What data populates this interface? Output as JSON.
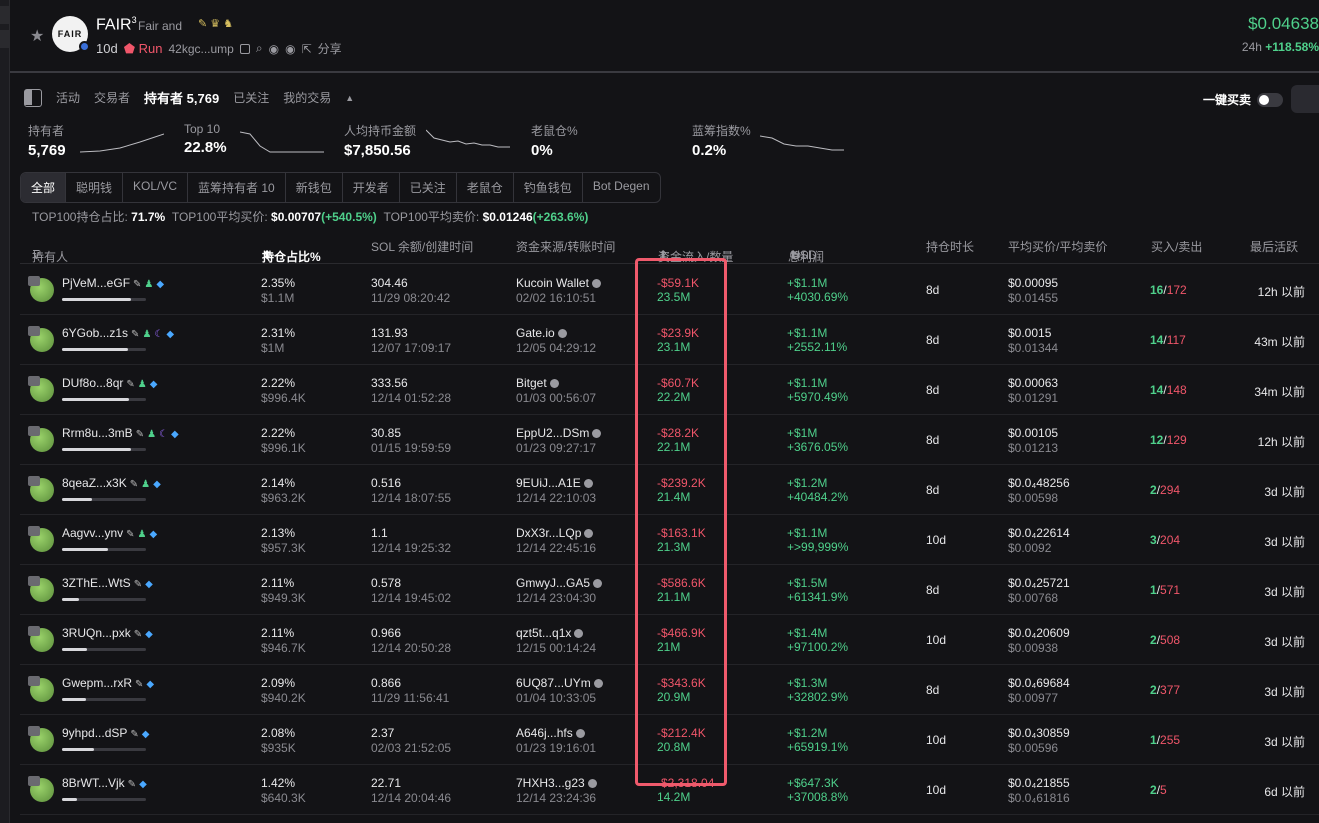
{
  "header": {
    "token_name": "FAIR",
    "token_sup": "3",
    "token_sub": "Fair and",
    "age": "10d",
    "run_label": "Run",
    "contract": "42kgc...ump",
    "share_label": "分享",
    "price": "$0.04638",
    "price_change_label": "24h",
    "price_change": "+118.58%",
    "logo_text": "FAIR"
  },
  "tabs": {
    "items": [
      "活动",
      "交易者"
    ],
    "active": "持有者 5,769",
    "extra": [
      "已关注",
      "我的交易"
    ],
    "quick_trade": "一键买卖"
  },
  "stats": [
    {
      "label": "持有者",
      "value": "5,769"
    },
    {
      "label": "Top 10",
      "value": "22.8%"
    },
    {
      "label": "人均持币金额",
      "value": "$7,850.56"
    },
    {
      "label": "老鼠仓%",
      "value": "0%"
    },
    {
      "label": "蓝筹指数%",
      "value": "0.2%"
    }
  ],
  "filters": [
    "全部",
    "聪明钱",
    "KOL/VC",
    "蓝筹持有者 10",
    "新钱包",
    "开发者",
    "已关注",
    "老鼠仓",
    "钓鱼钱包",
    "Bot Degen"
  ],
  "top100": {
    "hold_label": "TOP100持仓占比:",
    "hold_value": "71.7%",
    "buy_label": "TOP100平均买价:",
    "buy_value": "$0.00707",
    "buy_change": "(+540.5%)",
    "sell_label": "TOP100平均卖价:",
    "sell_value": "$0.01246",
    "sell_change": "(+263.6%)"
  },
  "columns": {
    "holder": "持有人",
    "share": "持仓占比%",
    "sol": "SOL 余额/创建时间",
    "source": "资金来源/转账时间",
    "flow": "资金流入/数量",
    "pnl": "总利润",
    "usd": "USD",
    "hold_time": "持仓时长",
    "avg": "平均买价/平均卖价",
    "bs": "买入/卖出",
    "last": "最后活跃"
  },
  "rows": [
    {
      "addr": "PjVeM...eGF",
      "share": "2.35%",
      "usd": "$1.1M",
      "sol": "304.46",
      "created": "11/29 08:20:42",
      "source": "Kucoin Wallet",
      "src_time": "02/02 16:10:51",
      "flow": "-$59.1K",
      "qty": "23.5M",
      "pnl": "+$1.1M",
      "pnl_pct": "+4030.69%",
      "hold": "8d",
      "buy": "$0.00095",
      "sell": "$0.01455",
      "buys": "16",
      "sells": "172",
      "last": "12h 以前",
      "bar": 0.82
    },
    {
      "addr": "6YGob...z1s",
      "share": "2.31%",
      "usd": "$1M",
      "sol": "131.93",
      "created": "12/07 17:09:17",
      "source": "Gate.io",
      "src_time": "12/05 04:29:12",
      "flow": "-$23.9K",
      "qty": "23.1M",
      "pnl": "+$1.1M",
      "pnl_pct": "+2552.11%",
      "hold": "8d",
      "buy": "$0.0015",
      "sell": "$0.01344",
      "buys": "14",
      "sells": "117",
      "last": "43m 以前",
      "bar": 0.78
    },
    {
      "addr": "DUf8o...8qr",
      "share": "2.22%",
      "usd": "$996.4K",
      "sol": "333.56",
      "created": "12/14 01:52:28",
      "source": "Bitget",
      "src_time": "01/03 00:56:07",
      "flow": "-$60.7K",
      "qty": "22.2M",
      "pnl": "+$1.1M",
      "pnl_pct": "+5970.49%",
      "hold": "8d",
      "buy": "$0.00063",
      "sell": "$0.01291",
      "buys": "14",
      "sells": "148",
      "last": "34m 以前",
      "bar": 0.8
    },
    {
      "addr": "Rrm8u...3mB",
      "share": "2.22%",
      "usd": "$996.1K",
      "sol": "30.85",
      "created": "01/15 19:59:59",
      "source": "EppU2...DSm",
      "src_time": "01/23 09:27:17",
      "flow": "-$28.2K",
      "qty": "22.1M",
      "pnl": "+$1M",
      "pnl_pct": "+3676.05%",
      "hold": "8d",
      "buy": "$0.00105",
      "sell": "$0.01213",
      "buys": "12",
      "sells": "129",
      "last": "12h 以前",
      "bar": 0.82
    },
    {
      "addr": "8qeaZ...x3K",
      "share": "2.14%",
      "usd": "$963.2K",
      "sol": "0.516",
      "created": "12/14 18:07:55",
      "source": "9EUiJ...A1E",
      "src_time": "12/14 22:10:03",
      "flow": "-$239.2K",
      "qty": "21.4M",
      "pnl": "+$1.2M",
      "pnl_pct": "+40484.2%",
      "hold": "8d",
      "buy": "$0.0₄48256",
      "sell": "$0.00598",
      "buys": "2",
      "sells": "294",
      "last": "3d 以前",
      "bar": 0.36
    },
    {
      "addr": "Aagvv...ynv",
      "share": "2.13%",
      "usd": "$957.3K",
      "sol": "1.1",
      "created": "12/14 19:25:32",
      "source": "DxX3r...LQp",
      "src_time": "12/14 22:45:16",
      "flow": "-$163.1K",
      "qty": "21.3M",
      "pnl": "+$1.1M",
      "pnl_pct": "+>99,999%",
      "hold": "10d",
      "buy": "$0.0₄22614",
      "sell": "$0.0092",
      "buys": "3",
      "sells": "204",
      "last": "3d 以前",
      "bar": 0.55
    },
    {
      "addr": "3ZThE...WtS",
      "share": "2.11%",
      "usd": "$949.3K",
      "sol": "0.578",
      "created": "12/14 19:45:02",
      "source": "GmwyJ...GA5",
      "src_time": "12/14 23:04:30",
      "flow": "-$586.6K",
      "qty": "21.1M",
      "pnl": "+$1.5M",
      "pnl_pct": "+61341.9%",
      "hold": "8d",
      "buy": "$0.0₄25721",
      "sell": "$0.00768",
      "buys": "1",
      "sells": "571",
      "last": "3d 以前",
      "bar": 0.2
    },
    {
      "addr": "3RUQn...pxk",
      "share": "2.11%",
      "usd": "$946.7K",
      "sol": "0.966",
      "created": "12/14 20:50:28",
      "source": "qzt5t...q1x",
      "src_time": "12/15 00:14:24",
      "flow": "-$466.9K",
      "qty": "21M",
      "pnl": "+$1.4M",
      "pnl_pct": "+97100.2%",
      "hold": "10d",
      "buy": "$0.0₄20609",
      "sell": "$0.00938",
      "buys": "2",
      "sells": "508",
      "last": "3d 以前",
      "bar": 0.3
    },
    {
      "addr": "Gwepm...rxR",
      "share": "2.09%",
      "usd": "$940.2K",
      "sol": "0.866",
      "created": "11/29 11:56:41",
      "source": "6UQ87...UYm",
      "src_time": "01/04 10:33:05",
      "flow": "-$343.6K",
      "qty": "20.9M",
      "pnl": "+$1.3M",
      "pnl_pct": "+32802.9%",
      "hold": "8d",
      "buy": "$0.0₄69684",
      "sell": "$0.00977",
      "buys": "2",
      "sells": "377",
      "last": "3d 以前",
      "bar": 0.28
    },
    {
      "addr": "9yhpd...dSP",
      "share": "2.08%",
      "usd": "$935K",
      "sol": "2.37",
      "created": "02/03 21:52:05",
      "source": "A646j...hfs",
      "src_time": "01/23 19:16:01",
      "flow": "-$212.4K",
      "qty": "20.8M",
      "pnl": "+$1.2M",
      "pnl_pct": "+65919.1%",
      "hold": "10d",
      "buy": "$0.0₄30859",
      "sell": "$0.00596",
      "buys": "1",
      "sells": "255",
      "last": "3d 以前",
      "bar": 0.38
    },
    {
      "addr": "8BrWT...Vjk",
      "share": "1.42%",
      "usd": "$640.3K",
      "sol": "22.71",
      "created": "12/14 20:04:46",
      "source": "7HXH3...g23",
      "src_time": "12/14 23:24:36",
      "flow": "-$2,318.04",
      "qty": "14.2M",
      "pnl": "+$647.3K",
      "pnl_pct": "+37008.8%",
      "hold": "10d",
      "buy": "$0.0₄21855",
      "sell": "$0.0₄61816",
      "buys": "2",
      "sells": "5",
      "last": "6d 以前",
      "bar": 0.18
    }
  ]
}
